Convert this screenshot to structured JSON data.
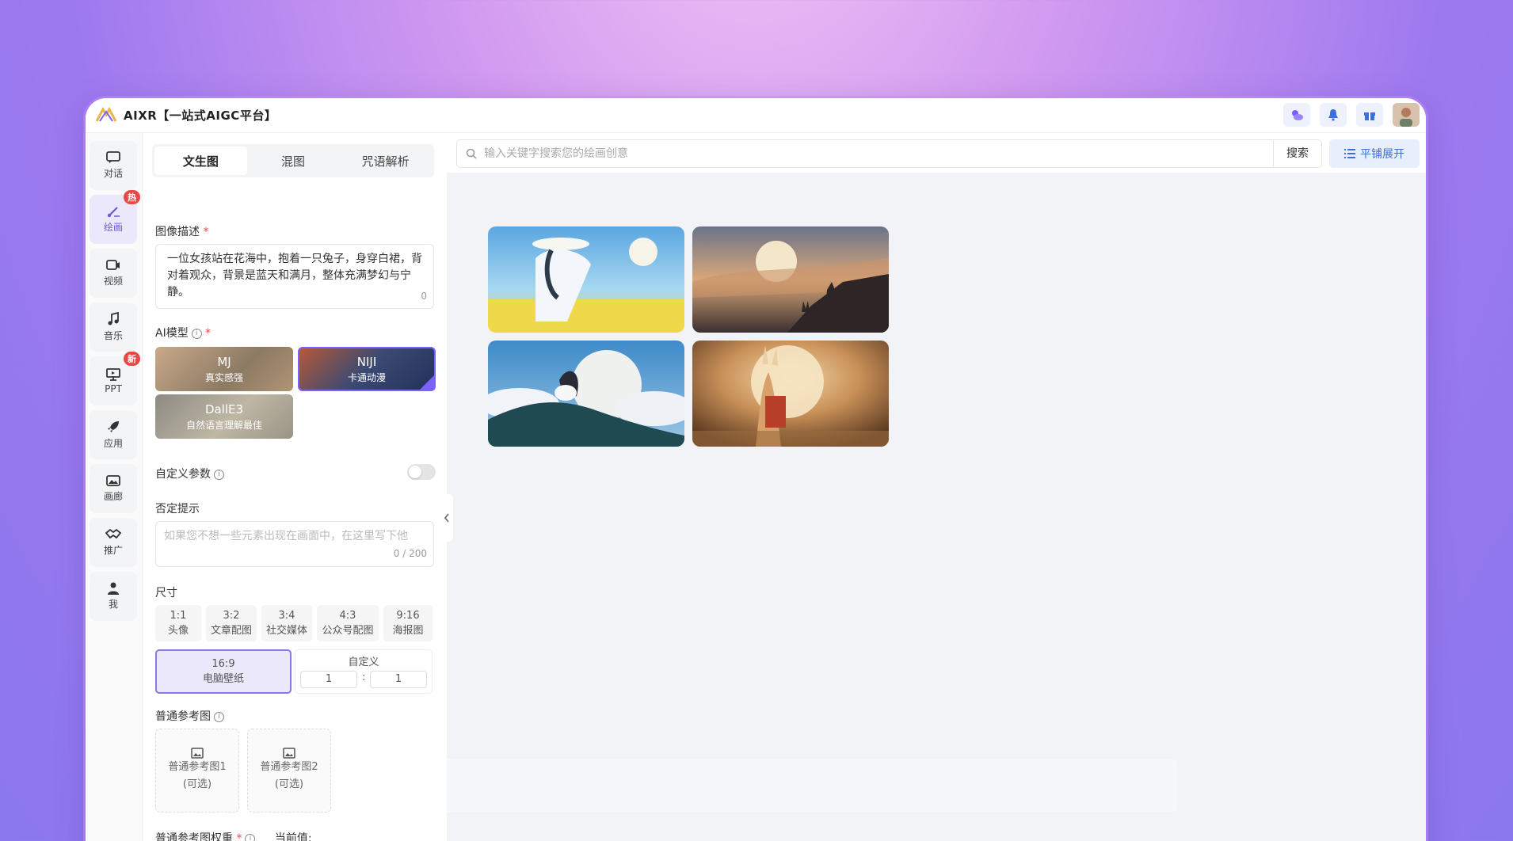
{
  "app": {
    "title": "AIXR【一站式AIGC平台】"
  },
  "rail": {
    "items": [
      {
        "label": "对话"
      },
      {
        "label": "绘画",
        "badge": "热"
      },
      {
        "label": "视频"
      },
      {
        "label": "音乐"
      },
      {
        "label": "PPT",
        "badge": "新"
      },
      {
        "label": "应用"
      },
      {
        "label": "画廊"
      },
      {
        "label": "推广"
      },
      {
        "label": "我"
      }
    ]
  },
  "panel": {
    "tabs": [
      "文生图",
      "混图",
      "咒语解析"
    ],
    "description_label": "图像描述",
    "description_text": "一位女孩站在花海中，抱着一只兔子，身穿白裙，背对着观众，背景是蓝天和满月，整体充满梦幻与宁静。",
    "description_count": "0",
    "model_label": "AI模型",
    "models": [
      {
        "name": "MJ",
        "sub": "真实感强"
      },
      {
        "name": "NIJI",
        "sub": "卡通动漫"
      },
      {
        "name": "DallE3",
        "sub": "自然语言理解最佳"
      }
    ],
    "custom_params_label": "自定义参数",
    "negative_label": "否定提示",
    "negative_placeholder": "如果您不想一些元素出现在画面中，在这里写下他",
    "negative_count": "0 / 200",
    "size_label": "尺寸",
    "sizes": [
      {
        "ratio": "1:1",
        "name": "头像"
      },
      {
        "ratio": "3:2",
        "name": "文章配图"
      },
      {
        "ratio": "3:4",
        "name": "社交媒体"
      },
      {
        "ratio": "4:3",
        "name": "公众号配图"
      },
      {
        "ratio": "9:16",
        "name": "海报图"
      },
      {
        "ratio": "16:9",
        "name": "电脑壁纸"
      }
    ],
    "custom_size_label": "自定义",
    "custom_w": "1",
    "custom_h": "1",
    "ref_label": "普通参考图",
    "ref_slots": [
      {
        "name": "普通参考图1",
        "optional": "(可选)"
      },
      {
        "name": "普通参考图2",
        "optional": "(可选)"
      }
    ],
    "weight_label": "普通参考图权重",
    "weight_current": "当前值:"
  },
  "main": {
    "search_placeholder": "输入关键字搜索您的绘画创意",
    "search_button": "搜索",
    "expand_button": "平铺展开"
  },
  "colors": {
    "accent": "#7b61ff",
    "badge": "#e54a45",
    "expand": "#3b6fe0"
  }
}
